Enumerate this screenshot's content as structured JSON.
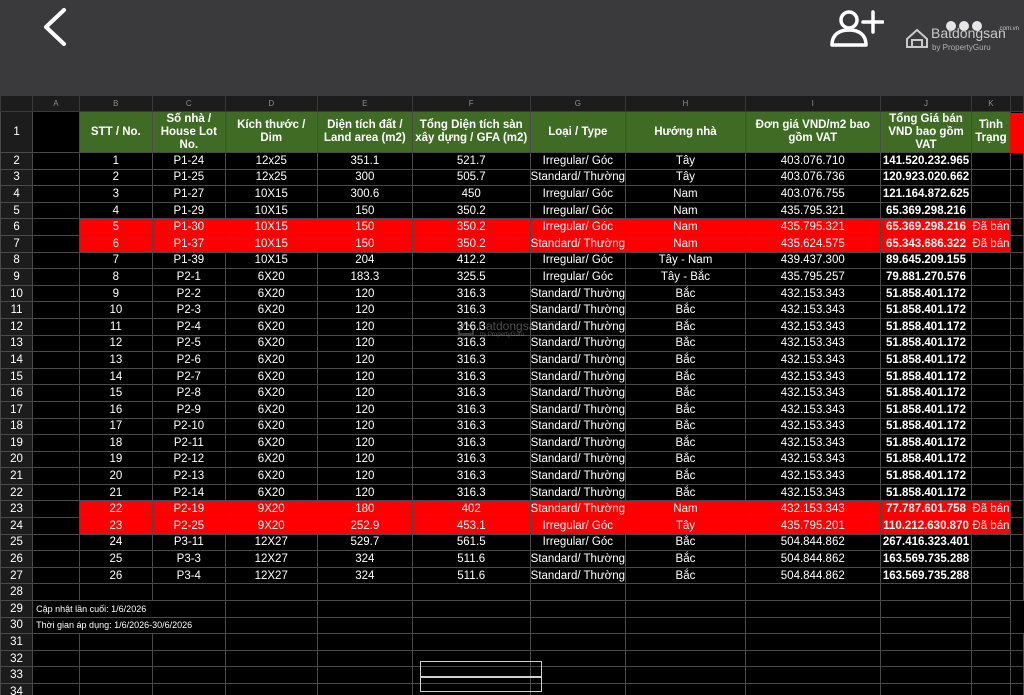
{
  "header": {
    "back_icon": "chevron-left-icon",
    "add_user_icon": "add-user-icon",
    "more_icon": "more-dots-icon",
    "brand_name": "Batdongsan",
    "brand_sub": "by PropertyGuru",
    "brand_tld": ".com.vn"
  },
  "sheet": {
    "columns": [
      "A",
      "B",
      "C",
      "D",
      "E",
      "F",
      "G",
      "H",
      "I",
      "J",
      "K"
    ],
    "headers": {
      "stt": "STT / No.",
      "lot": "Số nhà / House Lot No.",
      "dim": "Kích thước / Dim",
      "land": "Diện tích đất / Land area (m2)",
      "gfa": "Tổng Diện tích sàn xây dựng / GFA (m2)",
      "type": "Loại / Type",
      "dir": "Hướng nhà",
      "unit_price": "Đơn giá VND/m2 bao gồm VAT",
      "total_price": "Tổng Giá bán VND bao gồm VAT",
      "status": "Tình Trạng"
    },
    "rows": [
      {
        "n": "1",
        "lot": "P1-24",
        "dim": "12x25",
        "land": "351.1",
        "gfa": "521.7",
        "type": "Irregular/ Góc",
        "dir": "Tây",
        "unit": "403.076.710",
        "total": "141.520.232.965",
        "status": ""
      },
      {
        "n": "2",
        "lot": "P1-25",
        "dim": "12x25",
        "land": "300",
        "gfa": "505.7",
        "type": "Standard/ Thường",
        "dir": "Tây",
        "unit": "403.076.736",
        "total": "120.923.020.662",
        "status": ""
      },
      {
        "n": "3",
        "lot": "P1-27",
        "dim": "10X15",
        "land": "300.6",
        "gfa": "450",
        "type": "Irregular/ Góc",
        "dir": "Nam",
        "unit": "403.076.755",
        "total": "121.164.872.625",
        "status": ""
      },
      {
        "n": "4",
        "lot": "P1-29",
        "dim": "10X15",
        "land": "150",
        "gfa": "350.2",
        "type": "Irregular/ Góc",
        "dir": "Nam",
        "unit": "435.795.321",
        "total": "65.369.298.216",
        "status": ""
      },
      {
        "n": "5",
        "lot": "P1-30",
        "dim": "10X15",
        "land": "150",
        "gfa": "350.2",
        "type": "Irregular/ Góc",
        "dir": "Nam",
        "unit": "435.795.321",
        "total": "65.369.298.216",
        "status": "Đã bán"
      },
      {
        "n": "6",
        "lot": "P1-37",
        "dim": "10X15",
        "land": "150",
        "gfa": "350.2",
        "type": "Standard/ Thường",
        "dir": "Nam",
        "unit": "435.624.575",
        "total": "65.343.686.322",
        "status": "Đã bán"
      },
      {
        "n": "7",
        "lot": "P1-39",
        "dim": "10X15",
        "land": "204",
        "gfa": "412.2",
        "type": "Irregular/ Góc",
        "dir": "Tây - Nam",
        "unit": "439.437.300",
        "total": "89.645.209.155",
        "status": ""
      },
      {
        "n": "8",
        "lot": "P2-1",
        "dim": "6X20",
        "land": "183.3",
        "gfa": "325.5",
        "type": "Irregular/ Góc",
        "dir": "Tây - Bắc",
        "unit": "435.795.257",
        "total": "79.881.270.576",
        "status": ""
      },
      {
        "n": "9",
        "lot": "P2-2",
        "dim": "6X20",
        "land": "120",
        "gfa": "316.3",
        "type": "Standard/ Thường",
        "dir": "Bắc",
        "unit": "432.153.343",
        "total": "51.858.401.172",
        "status": ""
      },
      {
        "n": "10",
        "lot": "P2-3",
        "dim": "6X20",
        "land": "120",
        "gfa": "316.3",
        "type": "Standard/ Thường",
        "dir": "Bắc",
        "unit": "432.153.343",
        "total": "51.858.401.172",
        "status": ""
      },
      {
        "n": "11",
        "lot": "P2-4",
        "dim": "6X20",
        "land": "120",
        "gfa": "316.3",
        "type": "Standard/ Thường",
        "dir": "Bắc",
        "unit": "432.153.343",
        "total": "51.858.401.172",
        "status": ""
      },
      {
        "n": "12",
        "lot": "P2-5",
        "dim": "6X20",
        "land": "120",
        "gfa": "316.3",
        "type": "Standard/ Thường",
        "dir": "Bắc",
        "unit": "432.153.343",
        "total": "51.858.401.172",
        "status": ""
      },
      {
        "n": "13",
        "lot": "P2-6",
        "dim": "6X20",
        "land": "120",
        "gfa": "316.3",
        "type": "Standard/ Thường",
        "dir": "Bắc",
        "unit": "432.153.343",
        "total": "51.858.401.172",
        "status": ""
      },
      {
        "n": "14",
        "lot": "P2-7",
        "dim": "6X20",
        "land": "120",
        "gfa": "316.3",
        "type": "Standard/ Thường",
        "dir": "Bắc",
        "unit": "432.153.343",
        "total": "51.858.401.172",
        "status": ""
      },
      {
        "n": "15",
        "lot": "P2-8",
        "dim": "6X20",
        "land": "120",
        "gfa": "316.3",
        "type": "Standard/ Thường",
        "dir": "Bắc",
        "unit": "432.153.343",
        "total": "51.858.401.172",
        "status": ""
      },
      {
        "n": "16",
        "lot": "P2-9",
        "dim": "6X20",
        "land": "120",
        "gfa": "316.3",
        "type": "Standard/ Thường",
        "dir": "Bắc",
        "unit": "432.153.343",
        "total": "51.858.401.172",
        "status": ""
      },
      {
        "n": "17",
        "lot": "P2-10",
        "dim": "6X20",
        "land": "120",
        "gfa": "316.3",
        "type": "Standard/ Thường",
        "dir": "Bắc",
        "unit": "432.153.343",
        "total": "51.858.401.172",
        "status": ""
      },
      {
        "n": "18",
        "lot": "P2-11",
        "dim": "6X20",
        "land": "120",
        "gfa": "316.3",
        "type": "Standard/ Thường",
        "dir": "Bắc",
        "unit": "432.153.343",
        "total": "51.858.401.172",
        "status": ""
      },
      {
        "n": "19",
        "lot": "P2-12",
        "dim": "6X20",
        "land": "120",
        "gfa": "316.3",
        "type": "Standard/ Thường",
        "dir": "Bắc",
        "unit": "432.153.343",
        "total": "51.858.401.172",
        "status": ""
      },
      {
        "n": "20",
        "lot": "P2-13",
        "dim": "6X20",
        "land": "120",
        "gfa": "316.3",
        "type": "Standard/ Thường",
        "dir": "Bắc",
        "unit": "432.153.343",
        "total": "51.858.401.172",
        "status": ""
      },
      {
        "n": "21",
        "lot": "P2-14",
        "dim": "6X20",
        "land": "120",
        "gfa": "316.3",
        "type": "Standard/ Thường",
        "dir": "Bắc",
        "unit": "432.153.343",
        "total": "51.858.401.172",
        "status": ""
      },
      {
        "n": "22",
        "lot": "P2-19",
        "dim": "9X20",
        "land": "180",
        "gfa": "402",
        "type": "Standard/ Thường",
        "dir": "Nam",
        "unit": "432.153.343",
        "total": "77.787.601.758",
        "status": "Đã bán"
      },
      {
        "n": "23",
        "lot": "P2-25",
        "dim": "9X20",
        "land": "252.9",
        "gfa": "453.1",
        "type": "Irregular/ Góc",
        "dir": "Tây",
        "unit": "435.795.201",
        "total": "110.212.630.870",
        "status": "Đã bán"
      },
      {
        "n": "24",
        "lot": "P3-11",
        "dim": "12X27",
        "land": "529.7",
        "gfa": "561.5",
        "type": "Irregular/ Góc",
        "dir": "Bắc",
        "unit": "504.844.862",
        "total": "267.416.323.401",
        "status": ""
      },
      {
        "n": "25",
        "lot": "P3-3",
        "dim": "12X27",
        "land": "324",
        "gfa": "511.6",
        "type": "Standard/ Thường",
        "dir": "Bắc",
        "unit": "504.844.862",
        "total": "163.569.735.288",
        "status": ""
      },
      {
        "n": "26",
        "lot": "P3-4",
        "dim": "12X27",
        "land": "324",
        "gfa": "511.6",
        "type": "Standard/ Thường",
        "dir": "Bắc",
        "unit": "504.844.862",
        "total": "163.569.735.288",
        "status": ""
      }
    ],
    "notes": {
      "updated": "Cập nhật lần cuối: 1/6/2026",
      "period": "Thời gian áp dụng: 1/6/2026-30/6/2026"
    },
    "watermark": {
      "name": "Batdongsan",
      "sub": "by PropertyGuru",
      "tld": ".com.vn"
    },
    "colors": {
      "header_green": "#3f6b25",
      "sold_red": "#ff0000",
      "background": "#000000"
    }
  }
}
